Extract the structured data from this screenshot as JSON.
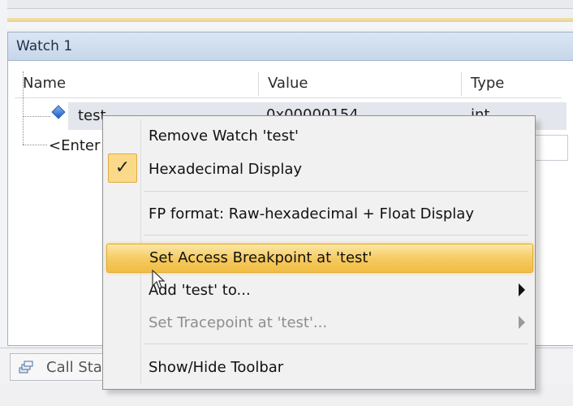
{
  "watch": {
    "title": "Watch 1",
    "columns": [
      "Name",
      "Value",
      "Type"
    ],
    "row_test": {
      "name": "test",
      "value": "0x00000154",
      "type": "int"
    },
    "row_enter": {
      "name": "<Enter"
    }
  },
  "bottom": {
    "tab_label": "Call Sta",
    "tab_icon": "call-stack-icon"
  },
  "context_menu": {
    "items": [
      {
        "label": "Remove Watch 'test'"
      },
      {
        "label": "Hexadecimal Display",
        "checked": true
      },
      {
        "label": "FP format: Raw-hexadecimal + Float Display"
      },
      {
        "label": "Set Access Breakpoint at 'test'",
        "highlighted": true
      },
      {
        "label": "Add 'test' to...",
        "submenu": true
      },
      {
        "label": "Set Tracepoint at 'test'...",
        "submenu": true,
        "disabled": true
      },
      {
        "label": "Show/Hide Toolbar"
      }
    ],
    "check_glyph": "✓"
  },
  "colors": {
    "highlight": "#f5c95e",
    "title_bar": "#c6d6ea",
    "menu_bg": "#f1f1f1"
  }
}
